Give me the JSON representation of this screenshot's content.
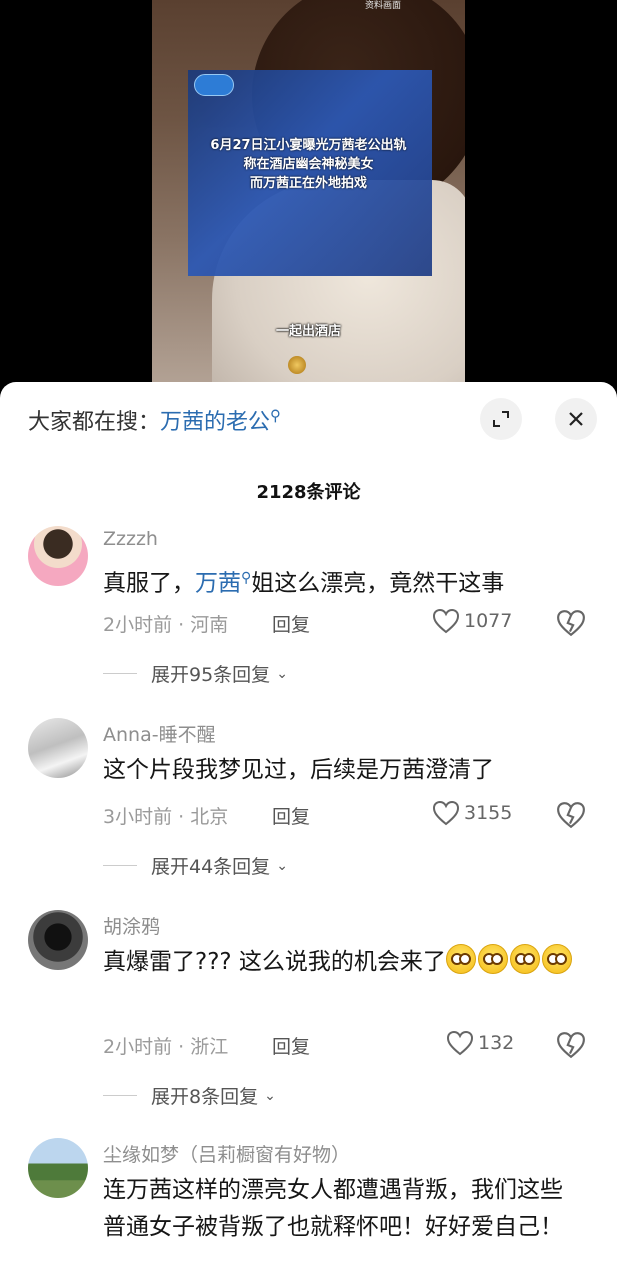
{
  "video": {
    "watermark": "资料画面",
    "headline": [
      "6月27日江小宴曝光万茜老公出轨",
      "称在酒店幽会神秘美女",
      "而万茜正在外地拍戏"
    ],
    "subtitle": "一起出酒店"
  },
  "search": {
    "prefix": "大家都在搜：",
    "keyword": "万茜的老公"
  },
  "comments_count": "2128条评论",
  "comments": [
    {
      "username": "Zzzzh",
      "text_before": "真服了，",
      "keyword": "万茜",
      "text_after": "姐这么漂亮，竟然干这事",
      "meta": "2小时前 · 河南",
      "reply_label": "回复",
      "likes": "1077",
      "expand": "展开95条回复"
    },
    {
      "username": "Anna-睡不醒",
      "text": "这个片段我梦见过，后续是万茜澄清了",
      "meta": "3小时前 · 北京",
      "reply_label": "回复",
      "likes": "3155",
      "expand": "展开44条回复"
    },
    {
      "username": "胡涂鸦",
      "text": "真爆雷了??? 这么说我的机会来了",
      "emoji": "smile-emoji",
      "meta": "2小时前 · 浙江",
      "reply_label": "回复",
      "likes": "132",
      "expand": "展开8条回复"
    },
    {
      "username": "尘缘如梦（吕莉橱窗有好物）",
      "text": "连万茜这样的漂亮女人都遭遇背叛，我们这些普通女子被背叛了也就释怀吧！好好爱自己！"
    }
  ],
  "colors": {
    "keyword": "#2b6cb0",
    "sheet": "#ffffff",
    "video_bg": "#000000"
  }
}
